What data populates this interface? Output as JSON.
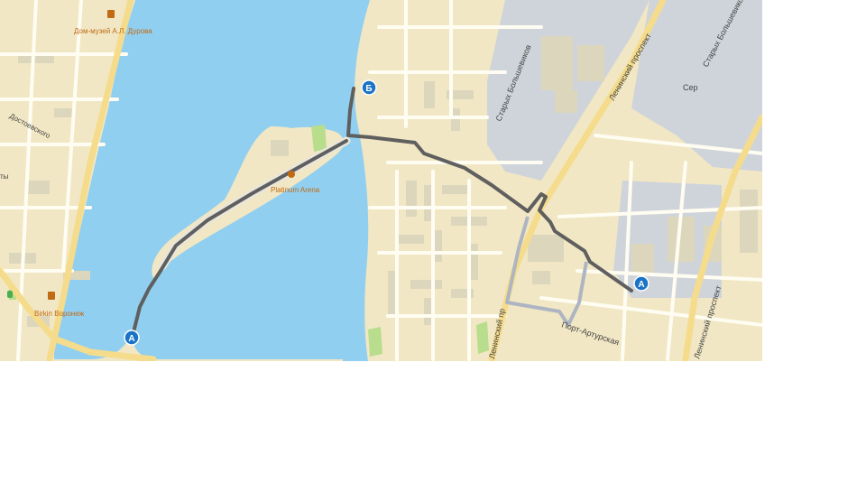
{
  "map": {
    "colors": {
      "land": "#f1e7c4",
      "water": "#91cff0",
      "road": "#fffdf2",
      "road_major": "#f5dc8c",
      "building": "#dcd6bd",
      "industrial": "#cfd4da",
      "park": "#b8dd8d",
      "route": "#5f5f5f",
      "route_alt": "#aeb5c2",
      "marker": "#1b73c6",
      "label": "#444444",
      "poi_label": "#c06a14"
    },
    "labels": {
      "durov_museum": "Дом-музей А.Л. Дурова",
      "dostoevsky": "Достоевского",
      "birkin": "Birkin Воронеж",
      "arena": "Platinum Arena",
      "starykh_bolshevikov_1": "Старых Большевиков",
      "starykh_bolshevikov_2": "Старых Большевиков",
      "leninsky_1": "Ленинский проспект",
      "leninsky_2": "Ленинский проспект",
      "leninsky_3": "Ленинский пр",
      "port_arturskaya": "Порт-Артурская",
      "ser": "Сер",
      "ty": "ты"
    },
    "markers": {
      "a_east": "А",
      "a_west": "А",
      "b": "Б"
    }
  }
}
